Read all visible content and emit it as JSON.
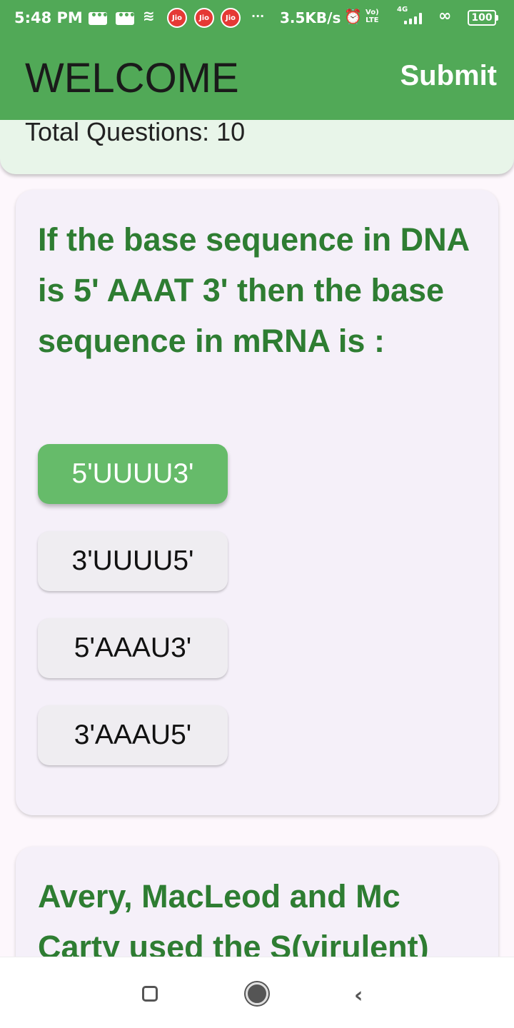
{
  "status_bar": {
    "time": "5:48 PM",
    "carrier_1": "Jio",
    "carrier_2": "Jio",
    "carrier_3": "Jio",
    "overflow": "···",
    "net_speed": "3.5KB/s",
    "volte_line1": "Vo)",
    "volte_line2": "LTE",
    "network_type": "4G",
    "battery": "100"
  },
  "app_bar": {
    "title": "WELCOME",
    "submit_label": "Submit",
    "color": "#51a957"
  },
  "header": {
    "total_questions": "Total Questions: 10"
  },
  "questions": [
    {
      "text": "If the base sequence in DNA is 5' AAAT 3' then the base sequence in mRNA is :",
      "options": [
        "5'UUUU3'",
        "3'UUUU5'",
        "5'AAAU3'",
        "3'AAAU5'"
      ],
      "selected_index": 0
    },
    {
      "text": "Avery, MacLeod and Mc Carty used the S(virulent)"
    }
  ],
  "colors": {
    "question_text": "#2e7d32",
    "selected_option": "#66bb6a",
    "card_bg": "#f5f0f9",
    "header_bg": "#e8f5e9"
  },
  "nav_bar": {
    "icons": [
      "recents-icon",
      "home-icon",
      "back-icon"
    ]
  }
}
